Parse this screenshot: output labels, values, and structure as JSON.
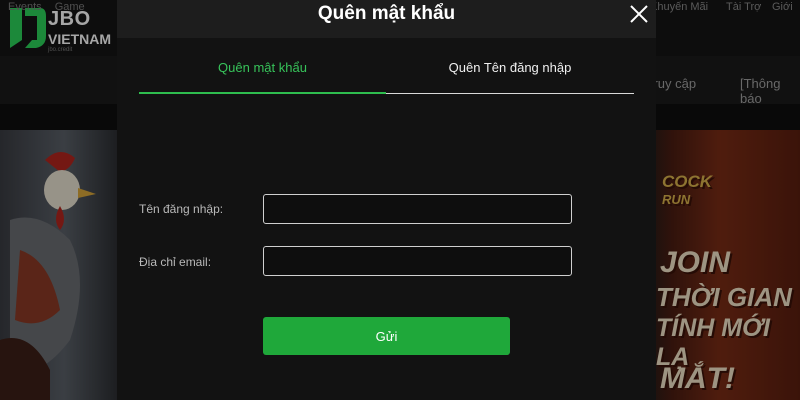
{
  "brand": {
    "name": "JBO",
    "country": "VIETNAM",
    "url": "jbo.credit"
  },
  "site_nav": {
    "left_items": [
      "Events",
      "Game"
    ],
    "right_items": [
      "Khuyến Mãi",
      "Tài Trợ",
      "Giới"
    ],
    "sub_right_items": [
      "Truy cập",
      "[Thông báo"
    ]
  },
  "hero": {
    "promo_lines": [
      "COCK",
      "RUN",
      "JOIN",
      "THỜI GIAN",
      "TÍNH MỚI LẠ",
      "MẮT!"
    ]
  },
  "modal": {
    "title": "Quên mật khẩu",
    "close_icon": "close-icon",
    "tabs": [
      {
        "label": "Quên mật khẩu",
        "active": true
      },
      {
        "label": "Quên Tên đăng nhập",
        "active": false
      }
    ],
    "fields": {
      "username": {
        "label": "Tên đăng nhập:",
        "value": ""
      },
      "email": {
        "label": "Địa chỉ email:",
        "value": ""
      }
    },
    "submit_label": "Gửi"
  },
  "colors": {
    "accent": "#2ebd4e",
    "button": "#1fa83a",
    "modal_bg": "#121212",
    "header_bg": "#1d1d1d"
  }
}
